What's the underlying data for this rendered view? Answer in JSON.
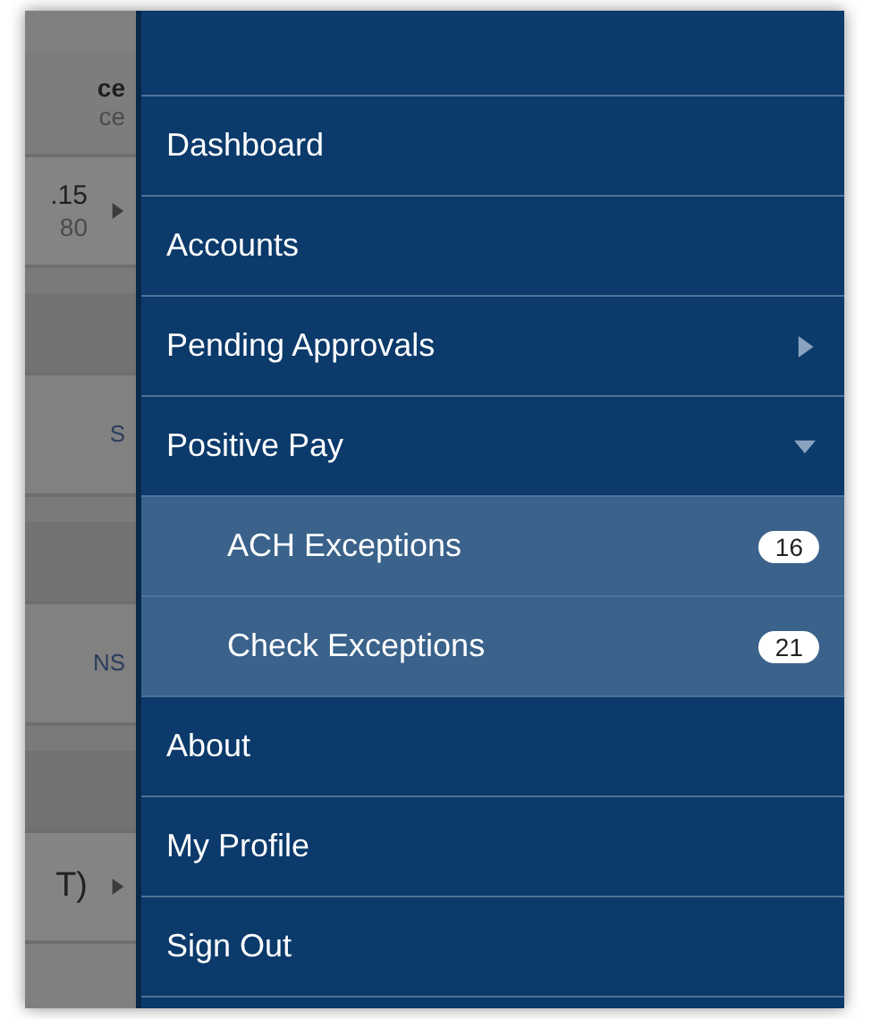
{
  "background_screen": {
    "rows": [
      {
        "kind": "header",
        "texts": [
          "ce",
          "ce"
        ]
      },
      {
        "kind": "account",
        "texts": [
          ".15",
          "80"
        ],
        "arrow": true
      },
      {
        "kind": "band"
      },
      {
        "kind": "link",
        "texts": [
          "S"
        ]
      },
      {
        "kind": "band"
      },
      {
        "kind": "link",
        "texts": [
          "NS"
        ]
      },
      {
        "kind": "band"
      },
      {
        "kind": "account",
        "texts": [
          "T)"
        ],
        "arrow": true
      }
    ]
  },
  "menu": {
    "items": [
      {
        "label": "Dashboard",
        "kind": "link"
      },
      {
        "label": "Accounts",
        "kind": "link"
      },
      {
        "label": "Pending Approvals",
        "kind": "parent",
        "expanded": false
      },
      {
        "label": "Positive Pay",
        "kind": "parent",
        "expanded": true,
        "children": [
          {
            "label": "ACH Exceptions",
            "badge": "16"
          },
          {
            "label": "Check Exceptions",
            "badge": "21"
          }
        ]
      },
      {
        "label": "About",
        "kind": "link"
      },
      {
        "label": "My Profile",
        "kind": "link"
      },
      {
        "label": "Sign Out",
        "kind": "link"
      }
    ]
  }
}
